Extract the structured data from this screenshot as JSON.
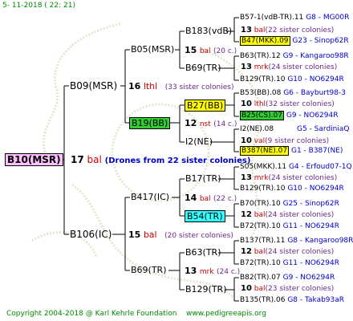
{
  "header": {
    "date": "5- 11-2018 ( 22: 21)"
  },
  "footer": {
    "copyright": "Copyright 2004-2018 @ Karl Kehrle Foundation",
    "website": "www.pedigreeapis.org"
  },
  "colors": {
    "root_bg": "#ffc0ff",
    "yellow": "#ffff00",
    "green": "#33cc33",
    "cyan": "#33ffff",
    "red": "#cc0000",
    "blue": "#0000cc"
  },
  "root": {
    "name": "B10(MSR)",
    "num": "17",
    "breed": "bal",
    "note": "(Drones from 22 sister colonies)"
  },
  "gen1": {
    "top": {
      "name": "B09(MSR)",
      "num": "16",
      "breed": "lthl",
      "note": "(33 sister colonies)"
    },
    "bottom": {
      "name": "B106(IC)",
      "num": "15",
      "breed": "bal",
      "note": "(20 sister colonies)"
    }
  },
  "gen2": [
    {
      "name": "B05(MSR)",
      "num": "15",
      "breed": "bal",
      "note": "(20 c.)"
    },
    {
      "name": "B19(BB)",
      "num": "12",
      "breed": "nst",
      "note": "(14 c.)"
    },
    {
      "name": "B417(IC)",
      "num": "14",
      "breed": "bal",
      "note": "(22 c.)"
    },
    {
      "name": "B69(TR)",
      "num": "13",
      "breed": "mrk",
      "note": "(24 c.)"
    }
  ],
  "gen3": [
    {
      "name": "B183(vdB)",
      "num": "13",
      "breed": "bal",
      "note": "(22 sister colonies)"
    },
    {
      "name": "B69(TR)",
      "num": "13",
      "breed": "mrk",
      "note": "(24 sister colonies)"
    },
    {
      "name": "B27(BB)",
      "num": "10",
      "breed": "lthl",
      "note": "(32 sister colonies)"
    },
    {
      "name": "I2(NE)",
      "num": "10",
      "breed": "val",
      "note": "(9 sister colonies)"
    },
    {
      "name": "B17(TR)",
      "num": "13",
      "breed": "mrk",
      "note": "(24 sister colonies)"
    },
    {
      "name": "B54(TR)",
      "num": "12",
      "breed": "bal",
      "note": "(24 sister colonies)"
    },
    {
      "name": "B63(TR)",
      "num": "12",
      "breed": "bal",
      "note": "(24 sister colonies)"
    },
    {
      "name": "B129(TR)",
      "num": "10",
      "breed": "bal",
      "note": "(23 sister colonies)"
    }
  ],
  "gen4": [
    {
      "name": "B57-1(vdB-TR).11",
      "info": "G8 - MG00R"
    },
    {
      "name": "B47(MKK).09",
      "info": "G23 - Sinop62R"
    },
    {
      "name": "B63(TR).12",
      "info": "G9 - Kangaroo98R"
    },
    {
      "name": "B129(TR).10",
      "info": "G10 - NO6294R"
    },
    {
      "name": "B53(BB).08",
      "info": "G6 - Bayburt98-3"
    },
    {
      "name": "B25(CS).07",
      "info": "G9 - NO6294R"
    },
    {
      "name": "I2(NE).08",
      "info": "G5 - SardiniaQ"
    },
    {
      "name": "B387(NE).07",
      "info": "G1 - B387(NE)"
    },
    {
      "name": "S05(MKK).11",
      "info": "G4 - Erfoud07-1Q"
    },
    {
      "name": "B129(TR).10",
      "info": "G10 - NO6294R"
    },
    {
      "name": "B70(TR).10",
      "info": "G25 - Sinop62R"
    },
    {
      "name": "B72(TR).10",
      "info": "G11 - NO6294R"
    },
    {
      "name": "B137(TR).11",
      "info": "G8 - Kangaroo98R"
    },
    {
      "name": "B72(TR).10",
      "info": "G11 - NO6294R"
    },
    {
      "name": "B82(TR).07",
      "info": "G9 - NO6294R"
    },
    {
      "name": "B135(TR).06",
      "info": "G8 - Takab93aR"
    }
  ]
}
